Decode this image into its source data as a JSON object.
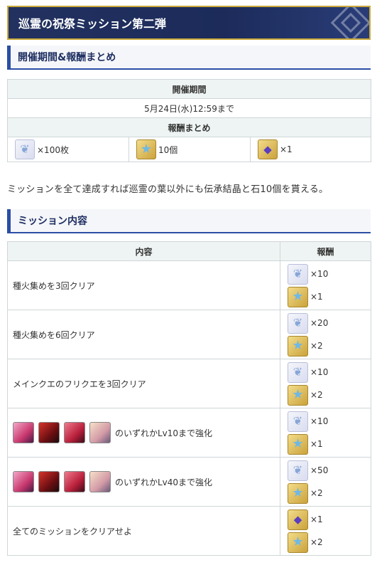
{
  "title": "巡霊の祝祭ミッション第二弾",
  "section1": {
    "heading": "開催期間&報酬まとめ",
    "period_header": "開催期間",
    "period_value": "5月24日(水)12:59まで",
    "rewards_header": "報酬まとめ",
    "rewards": [
      {
        "icon": "leaf-icon",
        "text": "×100枚"
      },
      {
        "icon": "star-icon",
        "text": "10個"
      },
      {
        "icon": "stone-icon",
        "text": "×1"
      }
    ]
  },
  "note": "ミッションを全て達成すれば巡霊の葉以外にも伝承結晶と石10個を貰える。",
  "section2": {
    "heading": "ミッション内容",
    "col_content": "内容",
    "col_reward": "報酬",
    "missions": [
      {
        "text": "種火集めを3回クリア",
        "rewards": [
          {
            "icon": "leaf-icon",
            "qty": "×10"
          },
          {
            "icon": "star-icon",
            "qty": "×1"
          }
        ]
      },
      {
        "text": "種火集めを6回クリア",
        "rewards": [
          {
            "icon": "leaf-icon",
            "qty": "×20"
          },
          {
            "icon": "star-icon",
            "qty": "×2"
          }
        ]
      },
      {
        "text": "メインクエのフリクエを3回クリア",
        "rewards": [
          {
            "icon": "leaf-icon",
            "qty": "×10"
          },
          {
            "icon": "star-icon",
            "qty": "×2"
          }
        ]
      },
      {
        "text": "のいずれかLv10まで強化",
        "servants": true,
        "rewards": [
          {
            "icon": "leaf-icon",
            "qty": "×10"
          },
          {
            "icon": "star-icon",
            "qty": "×1"
          }
        ]
      },
      {
        "text": "のいずれかLv40まで強化",
        "servants": true,
        "rewards": [
          {
            "icon": "leaf-icon",
            "qty": "×50"
          },
          {
            "icon": "star-icon",
            "qty": "×2"
          }
        ]
      },
      {
        "text": "全てのミッションをクリアせよ",
        "rewards": [
          {
            "icon": "stone-icon",
            "qty": "×1"
          },
          {
            "icon": "star-icon",
            "qty": "×2"
          }
        ]
      }
    ]
  }
}
